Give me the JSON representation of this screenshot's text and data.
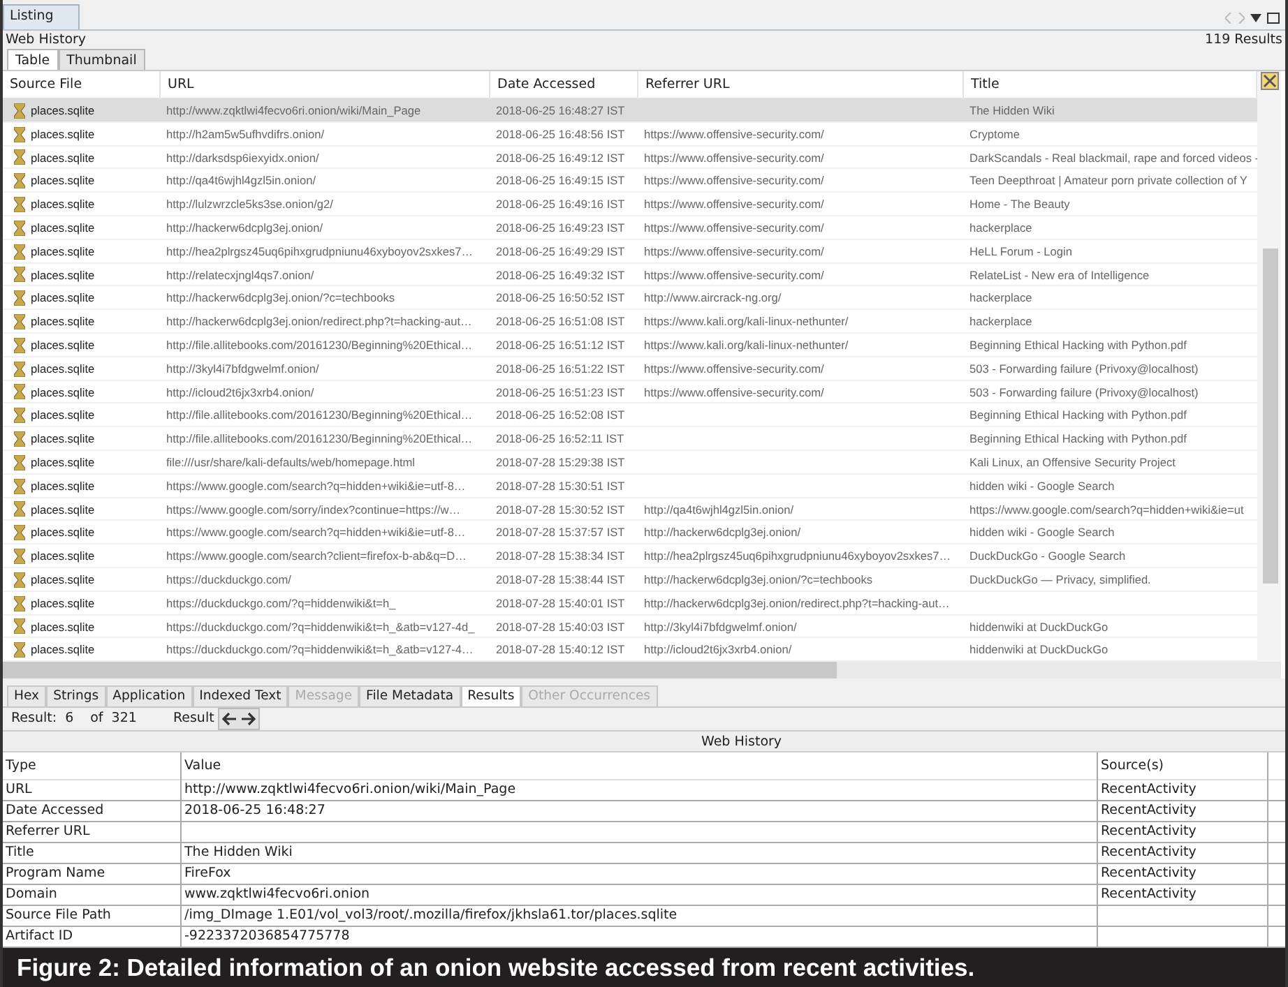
{
  "panel": {
    "tab": "Listing",
    "title": "Web History",
    "result_count": "119 Results"
  },
  "view_tabs": [
    {
      "label": "Table",
      "selected": true
    },
    {
      "label": "Thumbnail",
      "selected": false
    }
  ],
  "table": {
    "columns": [
      "Source File",
      "URL",
      "Date Accessed",
      "Referrer URL",
      "Title"
    ],
    "rows": [
      {
        "source_file": "places.sqlite",
        "url": "http://www.zqktlwi4fecvo6ri.onion/wiki/Main_Page",
        "date_accessed": "2018-06-25 16:48:27 IST",
        "title": "The Hidden Wiki",
        "selected": true
      },
      {
        "source_file": "places.sqlite",
        "url": "http://h2am5w5ufhvdifrs.onion/",
        "date_accessed": "2018-06-25 16:48:56 IST",
        "referrer_url": "https://www.offensive-security.com/",
        "title": "Cryptome",
        "selected": false
      },
      {
        "source_file": "places.sqlite",
        "url": "http://darksdsp6iexyidx.onion/",
        "date_accessed": "2018-06-25 16:49:12 IST",
        "referrer_url": "https://www.offensive-security.com/",
        "title": "DarkScandals - Real blackmail, rape and forced videos -",
        "selected": false
      },
      {
        "source_file": "places.sqlite",
        "url": "http://qa4t6wjhl4gzl5in.onion/",
        "date_accessed": "2018-06-25 16:49:15 IST",
        "referrer_url": "https://www.offensive-security.com/",
        "title": "Teen Deepthroat | Amateur porn private collection of Y",
        "selected": false
      },
      {
        "source_file": "places.sqlite",
        "url": "http://lulzwrzcle5ks3se.onion/g2/",
        "date_accessed": "2018-06-25 16:49:16 IST",
        "referrer_url": "https://www.offensive-security.com/",
        "title": "Home - The Beauty",
        "selected": false
      },
      {
        "source_file": "places.sqlite",
        "url": "http://hackerw6dcplg3ej.onion/",
        "date_accessed": "2018-06-25 16:49:23 IST",
        "referrer_url": "https://www.offensive-security.com/",
        "title": "hackerplace",
        "selected": false
      },
      {
        "source_file": "places.sqlite",
        "url": "http://hea2plrgsz45uq6pihxgrudpniunu46xyboyov2sxkes7…",
        "date_accessed": "2018-06-25 16:49:29 IST",
        "referrer_url": "https://www.offensive-security.com/",
        "title": "HeLL Forum - Login",
        "selected": false
      },
      {
        "source_file": "places.sqlite",
        "url": "http://relatecxjngl4qs7.onion/",
        "date_accessed": "2018-06-25 16:49:32 IST",
        "referrer_url": "https://www.offensive-security.com/",
        "title": "RelateList - New era of Intelligence",
        "selected": false
      },
      {
        "source_file": "places.sqlite",
        "url": "http://hackerw6dcplg3ej.onion/?c=techbooks",
        "date_accessed": "2018-06-25 16:50:52 IST",
        "referrer_url": "http://www.aircrack-ng.org/",
        "title": "hackerplace",
        "selected": false
      },
      {
        "source_file": "places.sqlite",
        "url": "http://hackerw6dcplg3ej.onion/redirect.php?t=hacking-aut…",
        "date_accessed": "2018-06-25 16:51:08 IST",
        "referrer_url": "https://www.kali.org/kali-linux-nethunter/",
        "title": "hackerplace",
        "selected": false
      },
      {
        "source_file": "places.sqlite",
        "url": "http://file.allitebooks.com/20161230/Beginning%20Ethical…",
        "date_accessed": "2018-06-25 16:51:12 IST",
        "referrer_url": "https://www.kali.org/kali-linux-nethunter/",
        "title": "Beginning Ethical Hacking with Python.pdf",
        "selected": false
      },
      {
        "source_file": "places.sqlite",
        "url": "http://3kyl4i7bfdgwelmf.onion/",
        "date_accessed": "2018-06-25 16:51:22 IST",
        "referrer_url": "https://www.offensive-security.com/",
        "title": "503 - Forwarding failure (Privoxy@localhost)",
        "selected": false
      },
      {
        "source_file": "places.sqlite",
        "url": "http://icloud2t6jx3xrb4.onion/",
        "date_accessed": "2018-06-25 16:51:23 IST",
        "referrer_url": "https://www.offensive-security.com/",
        "title": "503 - Forwarding failure (Privoxy@localhost)",
        "selected": false
      },
      {
        "source_file": "places.sqlite",
        "url": "http://file.allitebooks.com/20161230/Beginning%20Ethical…",
        "date_accessed": "2018-06-25 16:52:08 IST",
        "title": "Beginning Ethical Hacking with Python.pdf",
        "selected": false
      },
      {
        "source_file": "places.sqlite",
        "url": "http://file.allitebooks.com/20161230/Beginning%20Ethical…",
        "date_accessed": "2018-06-25 16:52:11 IST",
        "title": "Beginning Ethical Hacking with Python.pdf",
        "selected": false
      },
      {
        "source_file": "places.sqlite",
        "url": "file:///usr/share/kali-defaults/web/homepage.html",
        "date_accessed": "2018-07-28 15:29:38 IST",
        "title": "Kali Linux, an Offensive Security Project",
        "selected": false
      },
      {
        "source_file": "places.sqlite",
        "url": "https://www.google.com/search?q=hidden+wiki&ie=utf-8…",
        "date_accessed": "2018-07-28 15:30:51 IST",
        "title": "hidden wiki - Google Search",
        "selected": false
      },
      {
        "source_file": "places.sqlite",
        "url": "https://www.google.com/sorry/index?continue=https://w…",
        "date_accessed": "2018-07-28 15:30:52 IST",
        "referrer_url": "http://qa4t6wjhl4gzl5in.onion/",
        "title": "https://www.google.com/search?q=hidden+wiki&ie=ut",
        "selected": false
      },
      {
        "source_file": "places.sqlite",
        "url": "https://www.google.com/search?q=hidden+wiki&ie=utf-8…",
        "date_accessed": "2018-07-28 15:37:57 IST",
        "referrer_url": "http://hackerw6dcplg3ej.onion/",
        "title": "hidden wiki - Google Search",
        "selected": false
      },
      {
        "source_file": "places.sqlite",
        "url": "https://www.google.com/search?client=firefox-b-ab&q=D…",
        "date_accessed": "2018-07-28 15:38:34 IST",
        "referrer_url": "http://hea2plrgsz45uq6pihxgrudpniunu46xyboyov2sxkes7…",
        "title": "DuckDuckGo - Google Search",
        "selected": false
      },
      {
        "source_file": "places.sqlite",
        "url": "https://duckduckgo.com/",
        "date_accessed": "2018-07-28 15:38:44 IST",
        "referrer_url": "http://hackerw6dcplg3ej.onion/?c=techbooks",
        "title": "DuckDuckGo — Privacy, simplified.",
        "selected": false
      },
      {
        "source_file": "places.sqlite",
        "url": "https://duckduckgo.com/?q=hiddenwiki&t=h_",
        "date_accessed": "2018-07-28 15:40:01 IST",
        "referrer_url": "http://hackerw6dcplg3ej.onion/redirect.php?t=hacking-aut…",
        "selected": false
      },
      {
        "source_file": "places.sqlite",
        "url": "https://duckduckgo.com/?q=hiddenwiki&t=h_&atb=v127-4d_",
        "date_accessed": "2018-07-28 15:40:03 IST",
        "referrer_url": "http://3kyl4i7bfdgwelmf.onion/",
        "title": "hiddenwiki at DuckDuckGo",
        "selected": false
      },
      {
        "source_file": "places.sqlite",
        "url": "https://duckduckgo.com/?q=hiddenwiki&t=h_&atb=v127-4…",
        "date_accessed": "2018-07-28 15:40:12 IST",
        "referrer_url": "http://icloud2t6jx3xrb4.onion/",
        "title": "hiddenwiki at DuckDuckGo",
        "selected": false
      }
    ]
  },
  "detail_tabs": [
    {
      "label": "Hex",
      "selected": false,
      "disabled": false
    },
    {
      "label": "Strings",
      "selected": false,
      "disabled": false
    },
    {
      "label": "Application",
      "selected": false,
      "disabled": false
    },
    {
      "label": "Indexed Text",
      "selected": false,
      "disabled": false
    },
    {
      "label": "Message",
      "selected": false,
      "disabled": true
    },
    {
      "label": "File Metadata",
      "selected": false,
      "disabled": false
    },
    {
      "label": "Results",
      "selected": true,
      "disabled": false
    },
    {
      "label": "Other Occurrences",
      "selected": false,
      "disabled": true
    }
  ],
  "result_nav": {
    "label": "Result:",
    "index": "6",
    "total": "of  321",
    "button_label": "Result"
  },
  "detail": {
    "heading": "Web History",
    "columns": [
      "Type",
      "Value",
      "Source(s)"
    ],
    "rows": [
      {
        "type": "URL",
        "value": "http://www.zqktlwi4fecvo6ri.onion/wiki/Main_Page",
        "source": "RecentActivity"
      },
      {
        "type": "Date Accessed",
        "value": "2018-06-25 16:48:27",
        "source": "RecentActivity"
      },
      {
        "type": "Referrer URL",
        "source": "RecentActivity"
      },
      {
        "type": "Title",
        "value": "The Hidden Wiki",
        "source": "RecentActivity"
      },
      {
        "type": "Program Name",
        "value": "FireFox",
        "source": "RecentActivity"
      },
      {
        "type": "Domain",
        "value": "www.zqktlwi4fecvo6ri.onion",
        "source": "RecentActivity"
      },
      {
        "type": "Source File Path",
        "value": "/img_DImage 1.E01/vol_vol3/root/.mozilla/firefox/jkhsla61.tor/places.sqlite"
      },
      {
        "type": "Artifact ID",
        "value": "-9223372036854775778"
      }
    ]
  },
  "caption": "Figure 2: Detailed information of an onion website accessed from recent activities."
}
